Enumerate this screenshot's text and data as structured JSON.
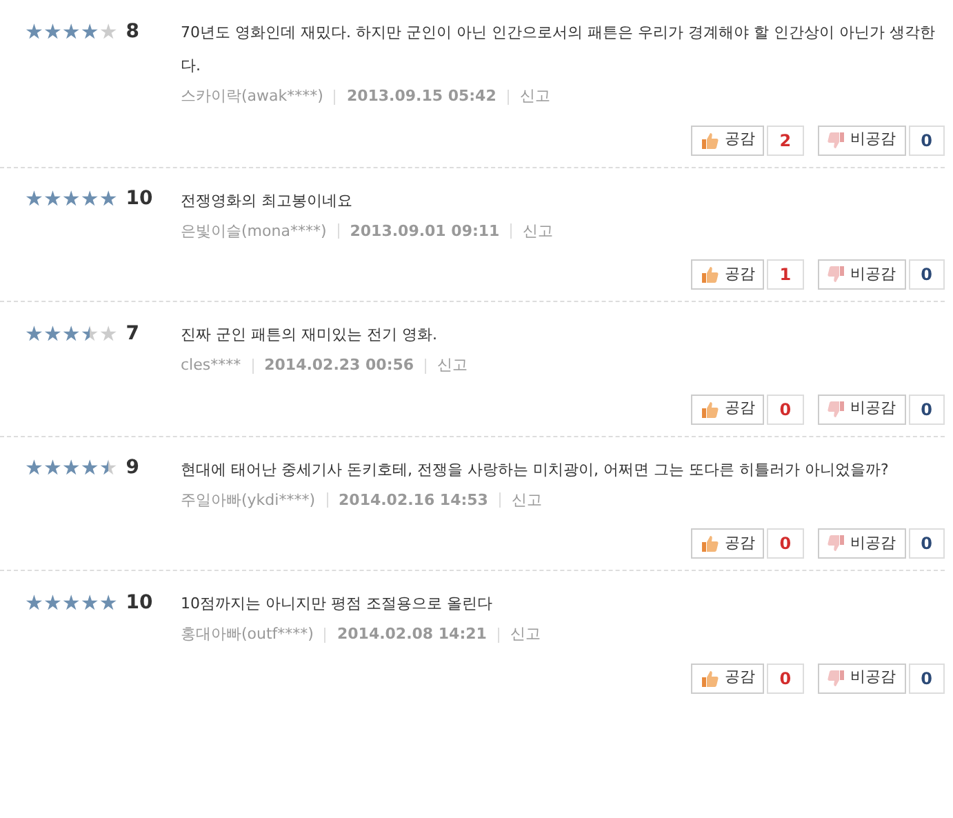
{
  "reviews": [
    {
      "stars": 4,
      "score": "8",
      "text": "70년도 영화인데 재밌다. 하지만 군인이 아닌 인간으로서의 패튼은 우리가 경계해야 할 인간상이 아닌가 생각한다.",
      "author": "스카이락(awak****)",
      "date": "2013.09.15 05:42",
      "report": "신고",
      "like_label": "공감",
      "likes": "2",
      "dislike_label": "비공감",
      "dislikes": "0"
    },
    {
      "stars": 5,
      "score": "10",
      "text": "전쟁영화의 최고봉이네요",
      "author": "은빛이슬(mona****)",
      "date": "2013.09.01 09:11",
      "report": "신고",
      "like_label": "공감",
      "likes": "1",
      "dislike_label": "비공감",
      "dislikes": "0"
    },
    {
      "stars": 3.5,
      "score": "7",
      "text": "진짜 군인 패튼의 재미있는 전기 영화.",
      "author": "cles****",
      "date": "2014.02.23 00:56",
      "report": "신고",
      "like_label": "공감",
      "likes": "0",
      "dislike_label": "비공감",
      "dislikes": "0"
    },
    {
      "stars": 4.5,
      "score": "9",
      "text": "현대에 태어난 중세기사 돈키호테, 전쟁을 사랑하는 미치광이, 어쩌면 그는 또다른 히틀러가 아니었을까?",
      "author": "주일아빠(ykdi****)",
      "date": "2014.02.16 14:53",
      "report": "신고",
      "like_label": "공감",
      "likes": "0",
      "dislike_label": "비공감",
      "dislikes": "0"
    },
    {
      "stars": 5,
      "score": "10",
      "text": "10점까지는 아니지만 평점 조절용으로 올린다",
      "author": "홍대아빠(outf****)",
      "date": "2014.02.08 14:21",
      "report": "신고",
      "like_label": "공감",
      "likes": "0",
      "dislike_label": "비공감",
      "dislikes": "0"
    }
  ]
}
